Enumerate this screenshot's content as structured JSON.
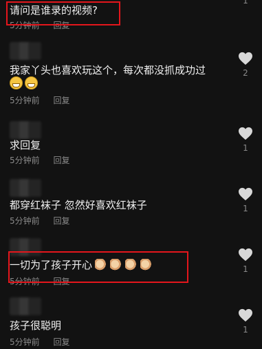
{
  "comments": [
    {
      "text": "请问是谁录的视频?",
      "time": "5分钟前",
      "reply": "回复",
      "likes": "1",
      "emoji_count": 0,
      "claps": 0
    },
    {
      "text": "我家丫头也喜欢玩这个，每次都没抓成功过",
      "time": "5分钟前",
      "reply": "回复",
      "likes": "2",
      "emoji_count": 2,
      "claps": 0
    },
    {
      "text": "求回复",
      "time": "5分钟前",
      "reply": "回复",
      "likes": "1",
      "emoji_count": 0,
      "claps": 0
    },
    {
      "text": "都穿红袜子 忽然好喜欢红袜子",
      "time": "5分钟前",
      "reply": "回复",
      "likes": "1",
      "emoji_count": 0,
      "claps": 0
    },
    {
      "text": "一切为了孩子开心",
      "time": "5分钟前",
      "reply": "回复",
      "likes": "1",
      "emoji_count": 0,
      "claps": 4
    },
    {
      "text": "孩子很聪明",
      "time": "5分钟前",
      "reply": "回复",
      "likes": "1",
      "emoji_count": 0,
      "claps": 0
    }
  ],
  "colors": {
    "background": "#121212",
    "highlight_box": "#e5161c",
    "meta_text": "#8a8a8a"
  },
  "icons": {
    "like": "heart-icon",
    "emoji": "grin-emoji",
    "clap": "clapping-hands-emoji"
  }
}
